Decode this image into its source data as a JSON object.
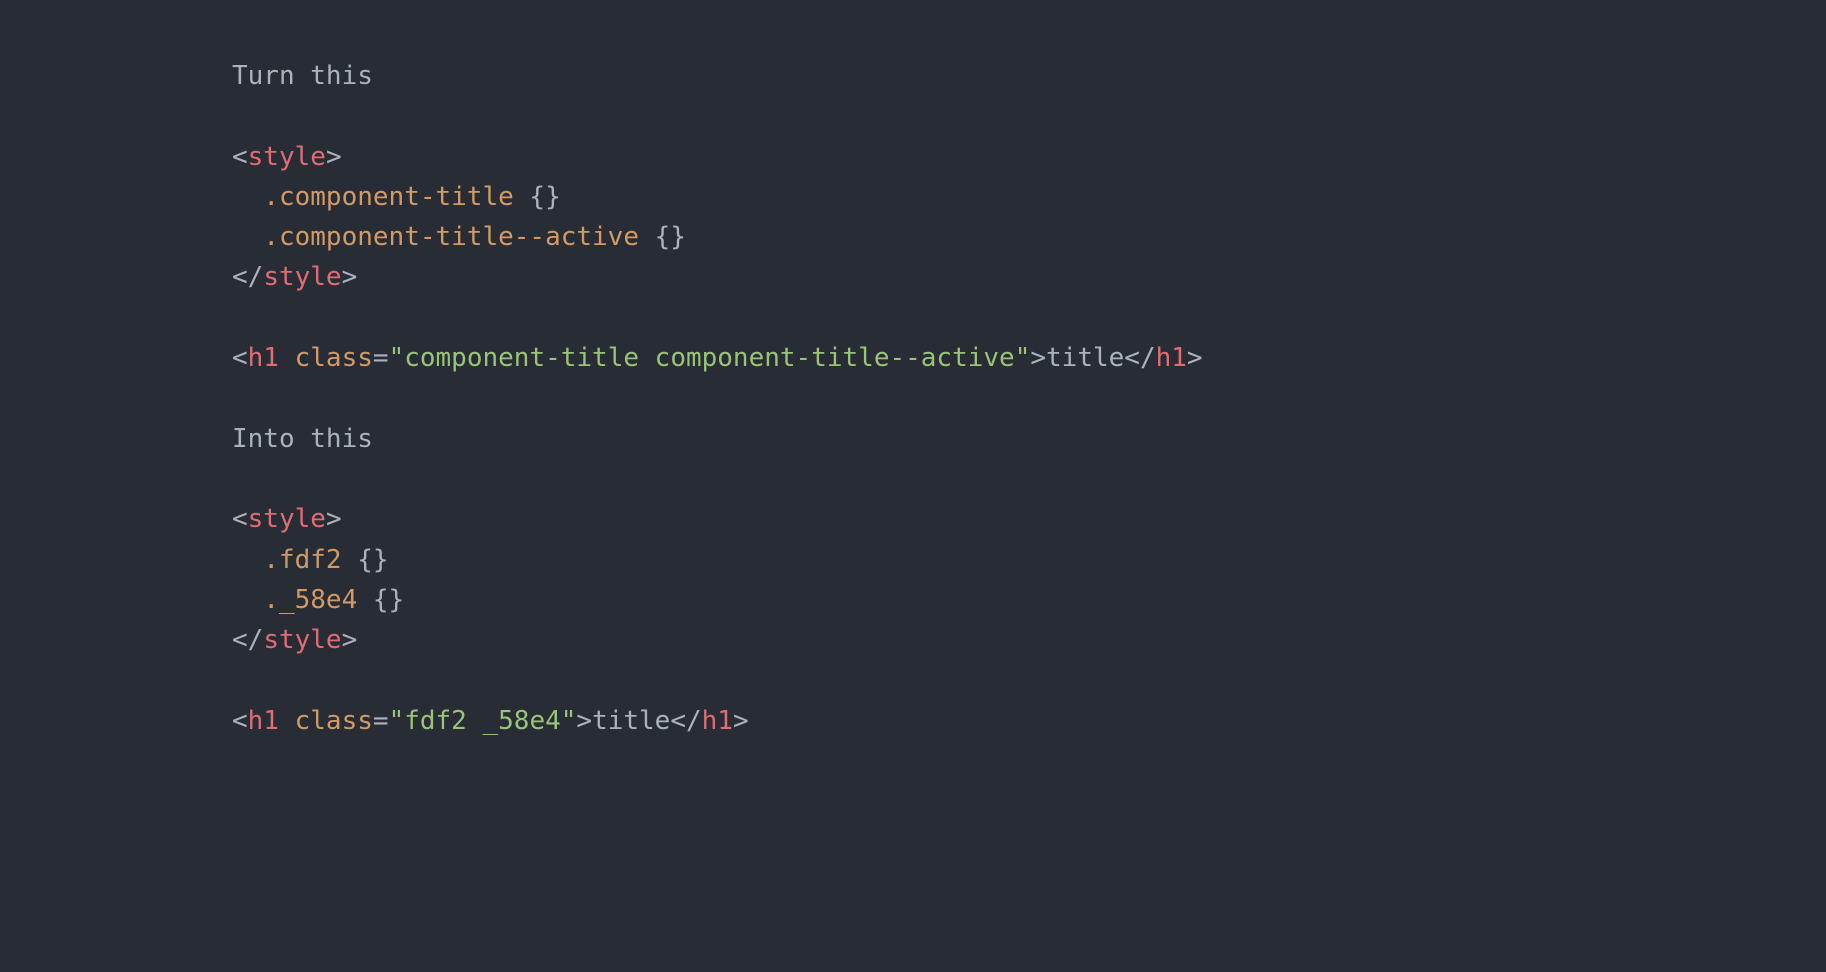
{
  "code": {
    "label_before": "Turn this",
    "label_after": "Into this",
    "before": {
      "tag_style": "style",
      "selector1": ".component-title",
      "selector2": ".component-title--active",
      "braces": "{}",
      "tag_h1": "h1",
      "attr_class": "class",
      "class_value": "\"component-title component-title--active\"",
      "h1_text": "title"
    },
    "after": {
      "tag_style": "style",
      "selector1": ".fdf2",
      "selector2": "._58e4",
      "braces": "{}",
      "tag_h1": "h1",
      "attr_class": "class",
      "class_value": "\"fdf2 _58e4\"",
      "h1_text": "title"
    }
  }
}
